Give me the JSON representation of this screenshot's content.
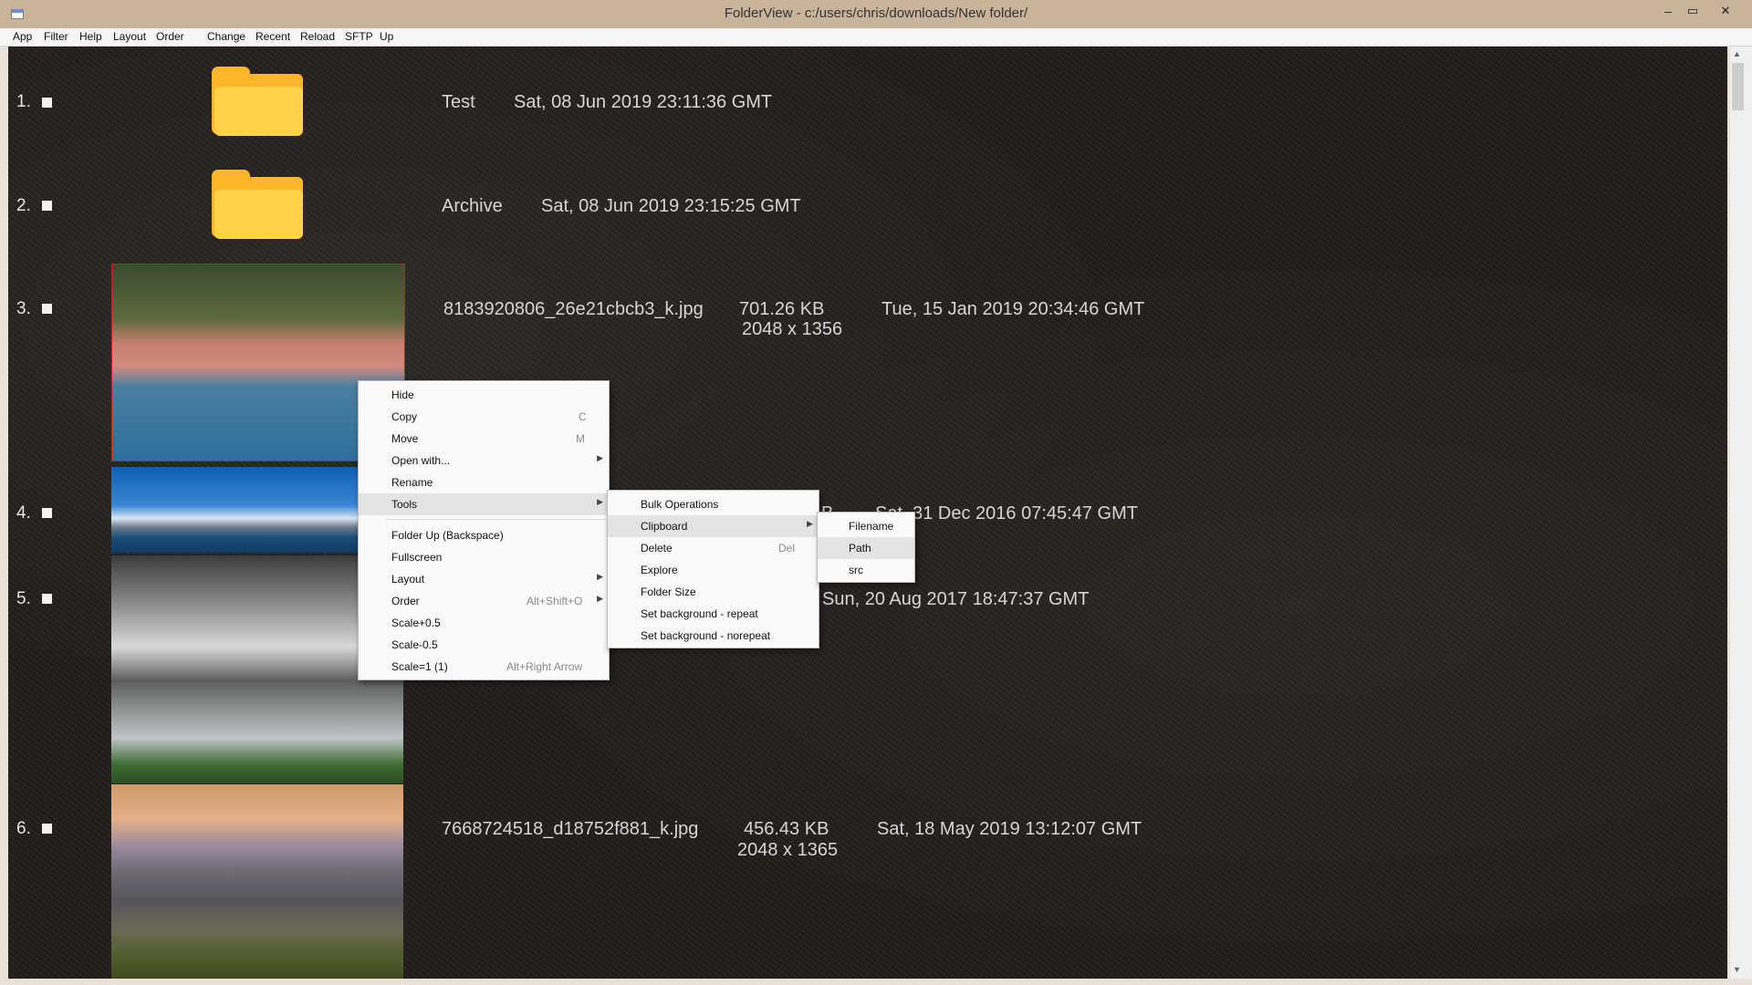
{
  "window": {
    "title": "FolderView - c:/users/chris/downloads/New folder/",
    "minimize": "–",
    "maximize": "▭",
    "close": "✕"
  },
  "menubar": [
    "App",
    "Filter",
    "Help",
    "Layout",
    "Order",
    "Change",
    "Recent",
    "Reload",
    "SFTP",
    "Up"
  ],
  "rows": [
    {
      "num": "1.",
      "name": "Test",
      "date": "Sat, 08 Jun 2019 23:11:36 GMT",
      "kind": "folder"
    },
    {
      "num": "2.",
      "name": "Archive",
      "date": "Sat, 08 Jun 2019 23:15:25 GMT",
      "kind": "folder"
    },
    {
      "num": "3.",
      "name": "8183920806_26e21cbcb3_k.jpg",
      "size": "701.26 KB",
      "dims": "2048 x 1356",
      "date": "Tue, 15 Jan 2019 20:34:46 GMT",
      "kind": "image"
    },
    {
      "num": "4.",
      "size_fragment": "B",
      "date": "Sat, 31 Dec 2016 07:45:47 GMT",
      "kind": "image"
    },
    {
      "num": "5.",
      "date": "Sun, 20 Aug 2017 18:47:37 GMT",
      "kind": "image"
    },
    {
      "num": "6.",
      "name": "7668724518_d18752f881_k.jpg",
      "size": "456.43 KB",
      "dims": "2048 x 1365",
      "date": "Sat, 18 May 2019 13:12:07 GMT",
      "kind": "image"
    }
  ],
  "context_menu": {
    "items": [
      {
        "label": "Hide",
        "shortcut": ""
      },
      {
        "label": "Copy",
        "shortcut": "C"
      },
      {
        "label": "Move",
        "shortcut": "M"
      },
      {
        "label": "Open with...",
        "shortcut": "",
        "submenu": true
      },
      {
        "label": "Rename",
        "shortcut": ""
      },
      {
        "label": "Tools",
        "shortcut": "",
        "submenu": true,
        "highlighted": true
      },
      {
        "label": "Folder Up (Backspace)",
        "shortcut": ""
      },
      {
        "label": "Fullscreen",
        "shortcut": ""
      },
      {
        "label": "Layout",
        "shortcut": "",
        "submenu": true
      },
      {
        "label": "Order",
        "shortcut": "Alt+Shift+O",
        "submenu": true
      },
      {
        "label": "Scale+0.5",
        "shortcut": ""
      },
      {
        "label": "Scale-0.5",
        "shortcut": ""
      },
      {
        "label": "Scale=1 (1)",
        "shortcut": "Alt+Right Arrow"
      }
    ]
  },
  "tools_menu": {
    "items": [
      {
        "label": "Bulk Operations",
        "shortcut": ""
      },
      {
        "label": "Clipboard",
        "shortcut": "",
        "submenu": true,
        "highlighted": true
      },
      {
        "label": "Delete",
        "shortcut": "Del"
      },
      {
        "label": "Explore",
        "shortcut": ""
      },
      {
        "label": "Folder Size",
        "shortcut": ""
      },
      {
        "label": "Set background - repeat",
        "shortcut": ""
      },
      {
        "label": "Set background - norepeat",
        "shortcut": ""
      }
    ]
  },
  "clipboard_menu": {
    "items": [
      {
        "label": "Filename",
        "highlighted": false
      },
      {
        "label": "Path",
        "highlighted": true
      },
      {
        "label": "src",
        "highlighted": false
      }
    ]
  },
  "colors": {
    "titlebar": "#c9b39a",
    "folder": "#fbb62a",
    "selection": "#c21f1f",
    "menu_highlight": "#e3e3e3"
  }
}
